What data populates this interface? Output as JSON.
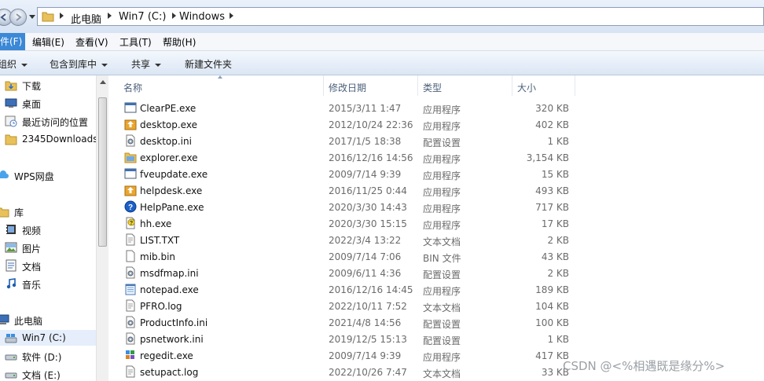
{
  "address": {
    "crumbs": [
      "此电脑",
      "Win7 (C:)",
      "Windows"
    ]
  },
  "menu": {
    "items": [
      "件(F)",
      "编辑(E)",
      "查看(V)",
      "工具(T)",
      "帮助(H)"
    ]
  },
  "toolbar": {
    "organize": "组织",
    "include_library": "包含到库中",
    "share": "共享",
    "new_folder": "新建文件夹"
  },
  "nav": {
    "items": [
      {
        "label": "下载",
        "icon": "download-folder-icon"
      },
      {
        "label": "桌面",
        "icon": "desktop-icon"
      },
      {
        "label": "最近访问的位置",
        "icon": "recent-places-icon"
      },
      {
        "label": "2345Downloads",
        "icon": "folder-icon"
      },
      {
        "label": "WPS网盘",
        "icon": "cloud-icon"
      },
      {
        "label": "库",
        "icon": "library-icon"
      },
      {
        "label": "视频",
        "icon": "video-icon"
      },
      {
        "label": "图片",
        "icon": "pictures-icon"
      },
      {
        "label": "文档",
        "icon": "documents-icon"
      },
      {
        "label": "音乐",
        "icon": "music-icon"
      },
      {
        "label": "此电脑",
        "icon": "computer-icon"
      },
      {
        "label": "Win7 (C:)",
        "icon": "drive-icon"
      },
      {
        "label": "软件 (D:)",
        "icon": "drive-icon"
      },
      {
        "label": "文档 (E:)",
        "icon": "drive-icon"
      }
    ]
  },
  "columns": {
    "name": "名称",
    "modified": "修改日期",
    "type": "类型",
    "size": "大小"
  },
  "files": [
    {
      "name": "ClearPE.exe",
      "date": "2015/3/11 1:47",
      "type": "应用程序",
      "size": "320 KB",
      "icon": "exe-window-icon"
    },
    {
      "name": "desktop.exe",
      "date": "2012/10/24 22:36",
      "type": "应用程序",
      "size": "402 KB",
      "icon": "installer-icon"
    },
    {
      "name": "desktop.ini",
      "date": "2017/1/5 18:38",
      "type": "配置设置",
      "size": "1 KB",
      "icon": "settings-file-icon"
    },
    {
      "name": "explorer.exe",
      "date": "2016/12/16 14:56",
      "type": "应用程序",
      "size": "3,154 KB",
      "icon": "explorer-folder-icon"
    },
    {
      "name": "fveupdate.exe",
      "date": "2009/7/14 9:39",
      "type": "应用程序",
      "size": "15 KB",
      "icon": "exe-window-icon"
    },
    {
      "name": "helpdesk.exe",
      "date": "2016/11/25 0:44",
      "type": "应用程序",
      "size": "493 KB",
      "icon": "installer-icon"
    },
    {
      "name": "HelpPane.exe",
      "date": "2020/3/30 14:43",
      "type": "应用程序",
      "size": "717 KB",
      "icon": "help-icon"
    },
    {
      "name": "hh.exe",
      "date": "2020/3/30 15:15",
      "type": "应用程序",
      "size": "17 KB",
      "icon": "help-file-icon"
    },
    {
      "name": "LIST.TXT",
      "date": "2022/3/4 13:22",
      "type": "文本文档",
      "size": "2 KB",
      "icon": "text-file-icon"
    },
    {
      "name": "mib.bin",
      "date": "2009/7/14 7:06",
      "type": "BIN 文件",
      "size": "43 KB",
      "icon": "blank-file-icon"
    },
    {
      "name": "msdfmap.ini",
      "date": "2009/6/11 4:36",
      "type": "配置设置",
      "size": "2 KB",
      "icon": "settings-file-icon"
    },
    {
      "name": "notepad.exe",
      "date": "2016/12/16 14:45",
      "type": "应用程序",
      "size": "189 KB",
      "icon": "notepad-icon"
    },
    {
      "name": "PFRO.log",
      "date": "2022/10/11 7:52",
      "type": "文本文档",
      "size": "104 KB",
      "icon": "text-file-icon"
    },
    {
      "name": "ProductInfo.ini",
      "date": "2021/4/8 14:56",
      "type": "配置设置",
      "size": "100 KB",
      "icon": "settings-file-icon"
    },
    {
      "name": "psnetwork.ini",
      "date": "2019/12/5 15:13",
      "type": "配置设置",
      "size": "1 KB",
      "icon": "settings-file-icon"
    },
    {
      "name": "regedit.exe",
      "date": "2009/7/14 9:39",
      "type": "应用程序",
      "size": "417 KB",
      "icon": "regedit-icon"
    },
    {
      "name": "setupact.log",
      "date": "2022/10/26 7:47",
      "type": "文本文档",
      "size": "33 KB",
      "icon": "text-file-icon"
    }
  ],
  "watermark": "CSDN @<%相遇既是缘分%>"
}
